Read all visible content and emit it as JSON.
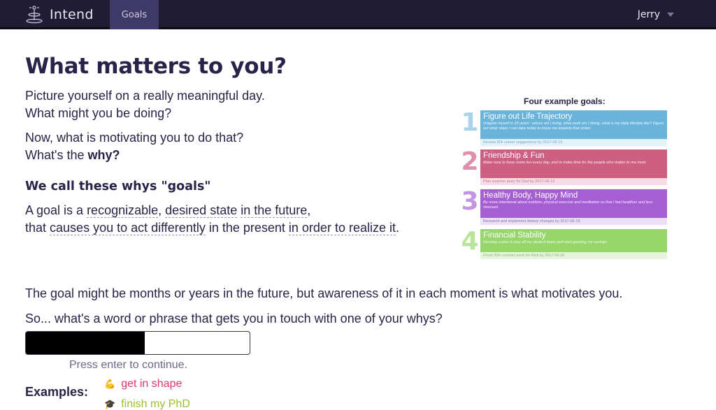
{
  "nav": {
    "app_name": "Intend",
    "tab_goals": "Goals",
    "user_name": "Jerry"
  },
  "main": {
    "title": "What matters to you?",
    "intro_line1": "Picture yourself on a really meaningful day.",
    "intro_line2": "What might you be doing?",
    "motivation_line1": "Now, what is motivating you to do that?",
    "motivation_line2_prefix": "What's the ",
    "motivation_line2_bold": "why?",
    "subheading": "We call these whys \"goals\"",
    "definition": {
      "p1": "A goal is a ",
      "t1": "recognizable",
      "p2": ", ",
      "t2": "desired state",
      "p3": " ",
      "t3": "in the future",
      "p4": ",",
      "p5": "that ",
      "t4": "causes you to act differently",
      "p6": " in the present ",
      "t5": "in order to realize it",
      "p7": "."
    },
    "awareness": "The goal might be months or years in the future, but awareness of it in each moment is what motivates you.",
    "question": "So... what's a word or phrase that gets you in touch with one of your whys?",
    "enter_hint": "Press enter to continue.",
    "examples_label": "Examples:",
    "examples": [
      {
        "emoji": "💪",
        "text": "get in shape",
        "color": "#e0336e"
      },
      {
        "emoji": "🎓",
        "text": "finish my PhD",
        "color": "#9bbf2e"
      }
    ]
  },
  "example_goals": {
    "title": "Four example goals:",
    "goals": [
      {
        "num": "1",
        "name": "Figure out Life Trajectory",
        "desc": "Imagine myself in 10 years - where am I living, what work am I doing, what is my daily lifestyle like? Figure out what steps I can take today to move me towards that vision.",
        "sub": "Review 80k career suggestions by 2017-06-19",
        "color": "#6ab4dc",
        "num_color": "#a9d3ea",
        "sub_bg": "#e3f1f9",
        "sub_color": "#7aaac6"
      },
      {
        "num": "2",
        "name": "Friendship & Fun",
        "desc": "Make sure to have some fun every day, and to make time for the people who matter to me most",
        "sub": "Plan surprise party for Dad by 2017-06-12",
        "color": "#cc5f82",
        "num_color": "#e08fa8",
        "sub_bg": "#f6dde5",
        "sub_color": "#b77b8e"
      },
      {
        "num": "3",
        "name": "Healthy Body, Happy Mind",
        "desc": "Be more intentional about nutrition, physical exercise and meditation so that I feel healthier and less stressed.",
        "sub": "Research and implement dietary changes by 2017-06-19",
        "color": "#a55fd3",
        "num_color": "#c595e3",
        "sub_bg": "#ecdff6",
        "sub_color": "#8e6fa6"
      },
      {
        "num": "4",
        "name": "Financial Stability",
        "desc": "Develop a plan to pay off my student loans and start growing my savings",
        "sub": "Finish $2k contract work for Rick by 2017-06-26",
        "color": "#96d66b",
        "num_color": "#b9e49b",
        "sub_bg": "#e6f5dc",
        "sub_color": "#8fb57a"
      }
    ]
  }
}
